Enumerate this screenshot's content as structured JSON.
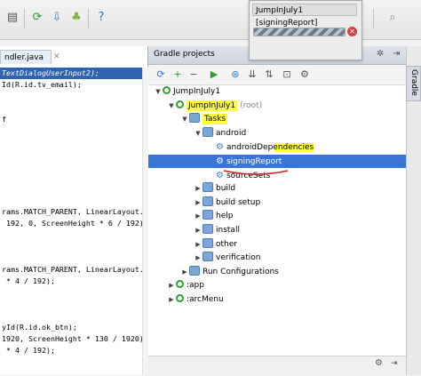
{
  "toolbar": {
    "icons": [
      "save-icon",
      "refresh-icon",
      "download-icon",
      "android-icon",
      "question-icon"
    ]
  },
  "popup": {
    "title": "JumpInJuly1 [signingReport]",
    "cancel_glyph": "✕"
  },
  "editor": {
    "tab_label": "ndler.java",
    "close_glyph": "✕",
    "lines": [
      {
        "text": "TextDialogUserInput2);",
        "highlight": true
      },
      {
        "text": "Id(R.id.tv_email);"
      },
      {
        "text": ""
      },
      {
        "text": ""
      },
      {
        "text": "f"
      },
      {
        "text": ""
      },
      {
        "text": ""
      },
      {
        "text": ""
      },
      {
        "text": ""
      },
      {
        "text": ""
      },
      {
        "text": ""
      },
      {
        "text": ""
      },
      {
        "text": "rams.MATCH_PARENT, LinearLayout."
      },
      {
        "text": " 192, 0, ScreenHeight * 6 / 192)"
      },
      {
        "text": ""
      },
      {
        "text": ""
      },
      {
        "text": ""
      },
      {
        "text": "rams.MATCH_PARENT, LinearLayout."
      },
      {
        "text": " * 4 / 192);"
      },
      {
        "text": ""
      },
      {
        "text": ""
      },
      {
        "text": ""
      },
      {
        "text": "yId(R.id.ok_btn);"
      },
      {
        "text": "1920, ScreenHeight * 130 / 1920)"
      },
      {
        "text": " * 4 / 192);"
      }
    ]
  },
  "gradle": {
    "title": "Gradle projects",
    "header_icons": [
      "settings-icon",
      "minimize-icon"
    ],
    "tb_icons": [
      "refresh-icon",
      "add-icon",
      "remove-icon",
      "run-icon",
      "toggle-icon",
      "collapse-icon",
      "link-icon",
      "offline-icon",
      "settings-icon"
    ],
    "tree": [
      {
        "label": "JumpInJuly1",
        "indent": 0,
        "arrow": "▼",
        "icon": "module",
        "selected": false,
        "marked": false
      },
      {
        "label": "JumpInJuly1",
        "suffix": "(root)",
        "indent": 1,
        "arrow": "▼",
        "icon": "module",
        "selected": false,
        "marked": true
      },
      {
        "label": "Tasks",
        "indent": 2,
        "arrow": "▼",
        "icon": "folder",
        "selected": false,
        "marked": true
      },
      {
        "label": "android",
        "indent": 3,
        "arrow": "▼",
        "icon": "folder",
        "selected": false,
        "marked": false
      },
      {
        "label": "androidDependencies",
        "indent": 4,
        "arrow": "",
        "icon": "gear",
        "selected": false,
        "marked": false
      },
      {
        "label": "signingReport",
        "indent": 4,
        "arrow": "",
        "icon": "gear",
        "selected": true,
        "marked": false
      },
      {
        "label": "sourceSets",
        "indent": 4,
        "arrow": "",
        "icon": "gear",
        "selected": false,
        "marked": false
      },
      {
        "label": "build",
        "indent": 3,
        "arrow": "▶",
        "icon": "folder",
        "selected": false,
        "marked": false
      },
      {
        "label": "build setup",
        "indent": 3,
        "arrow": "▶",
        "icon": "folder",
        "selected": false,
        "marked": false
      },
      {
        "label": "help",
        "indent": 3,
        "arrow": "▶",
        "icon": "folder",
        "selected": false,
        "marked": false
      },
      {
        "label": "install",
        "indent": 3,
        "arrow": "▶",
        "icon": "folder",
        "selected": false,
        "marked": false
      },
      {
        "label": "other",
        "indent": 3,
        "arrow": "▶",
        "icon": "folder",
        "selected": false,
        "marked": false
      },
      {
        "label": "verification",
        "indent": 3,
        "arrow": "▶",
        "icon": "folder",
        "selected": false,
        "marked": false
      },
      {
        "label": "Run Configurations",
        "indent": 2,
        "arrow": "▶",
        "icon": "folder",
        "selected": false,
        "marked": false
      },
      {
        "label": ":app",
        "indent": 1,
        "arrow": "▶",
        "icon": "module",
        "selected": false,
        "marked": false
      },
      {
        "label": ":arcMenu",
        "indent": 1,
        "arrow": "▶",
        "icon": "module",
        "selected": false,
        "marked": false
      }
    ]
  },
  "side": {
    "tab_label": "Gradle"
  },
  "colors": {
    "selection": "#3875d7",
    "marker": "#ffff3c",
    "underline": "#d42020"
  }
}
